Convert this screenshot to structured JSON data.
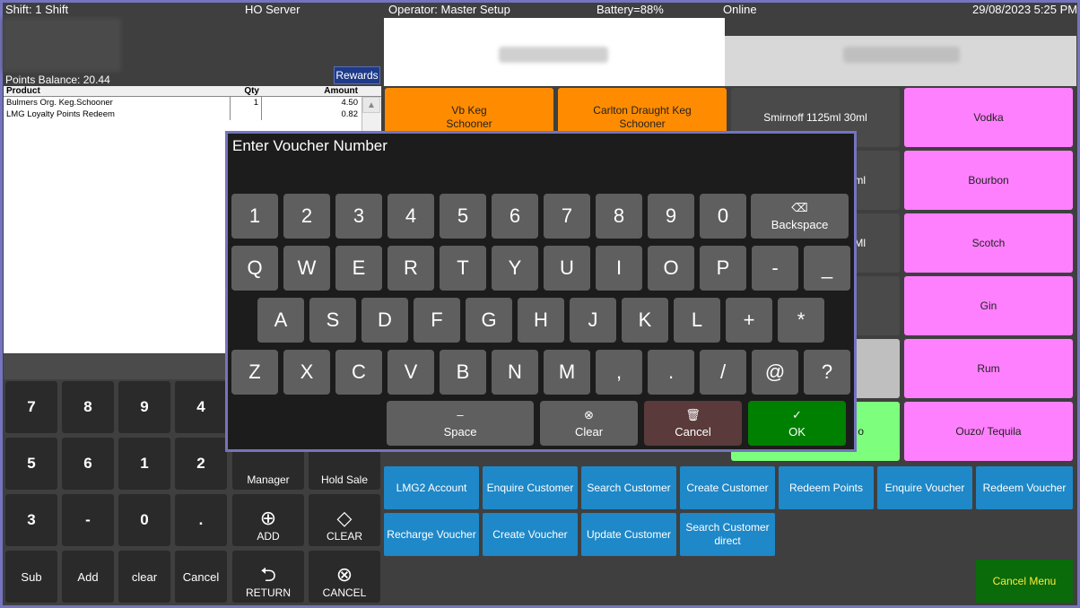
{
  "status": {
    "shift": "Shift: 1 Shift",
    "server": "HO Server",
    "operator": "Operator: Master Setup",
    "battery": "Battery=88%",
    "online": "Online",
    "datetime": "29/08/2023 5:25 PM"
  },
  "customer": {
    "points_balance": "Points Balance: 20.44",
    "rewards_label": "Rewards"
  },
  "order": {
    "headers": {
      "product": "Product",
      "qty": "Qty",
      "amount": "Amount"
    },
    "rows": [
      {
        "product": "Bulmers Org.  Keg.Schooner",
        "qty": "1",
        "amount": "4.50"
      },
      {
        "product": "LMG Loyalty Points Redeem",
        "qty": "",
        "amount": "0.82"
      }
    ]
  },
  "keypad": {
    "keys": [
      "7",
      "8",
      "9",
      "4",
      "5",
      "6",
      "1",
      "2",
      "3",
      "-",
      "0",
      "."
    ],
    "sub": "Sub",
    "add": "Add",
    "clear": "clear",
    "cancel": "Cancel"
  },
  "actions": {
    "manager": "Manager",
    "hold_sale": "Hold Sale",
    "add": "ADD",
    "clear": "CLEAR",
    "return": "RETURN",
    "cancel": "CANCEL"
  },
  "products": {
    "vb": [
      "Vb Keg",
      "Schooner"
    ],
    "carlton": [
      "Carlton Draught Keg",
      "Schooner"
    ],
    "smirnoff": "Smirnoff 1125ml 30ml",
    "dark_row2_suffix": "ml",
    "dark_row3_suffix": "Ml",
    "vodka": "Vodka",
    "bourbon": "Bourbon",
    "scotch": "Scotch",
    "gin": "Gin",
    "rum": "Rum",
    "ouzo": "Ouzo/ Tequila",
    "green_suffix": "o"
  },
  "customer_buttons": [
    "LMG2 Account",
    "Enquire Customer",
    "Search Customer",
    "Create Customer",
    "Redeem Points",
    "Enquire Voucher",
    "Redeem Voucher",
    "Recharge Voucher",
    "Create Voucher",
    "Update Customer",
    "Search Customer direct"
  ],
  "cancel_menu": "Cancel Menu",
  "dialog": {
    "title": "Enter Voucher Number",
    "row1": [
      "1",
      "2",
      "3",
      "4",
      "5",
      "6",
      "7",
      "8",
      "9",
      "0"
    ],
    "row2": [
      "Q",
      "W",
      "E",
      "R",
      "T",
      "Y",
      "U",
      "I",
      "O",
      "P",
      "-",
      "_"
    ],
    "row3": [
      "A",
      "S",
      "D",
      "F",
      "G",
      "H",
      "J",
      "K",
      "L",
      "+",
      "*"
    ],
    "row4": [
      "Z",
      "X",
      "C",
      "V",
      "B",
      "N",
      "M",
      ",",
      ".",
      "/",
      "@",
      "?"
    ],
    "backspace": "Backspace",
    "space": "Space",
    "clear": "Clear",
    "cancel": "Cancel",
    "ok": "OK",
    "colors": {
      "ok": "#008000",
      "cancel": "#5a3a3a"
    }
  }
}
